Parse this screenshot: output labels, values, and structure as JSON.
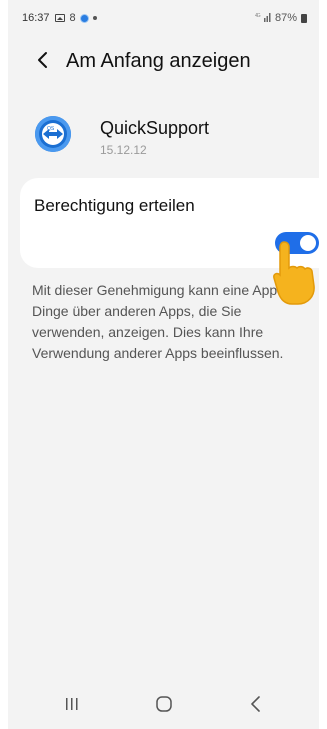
{
  "status_bar": {
    "time": "16:37",
    "notification_number": "8",
    "battery": "87%",
    "network": "4G"
  },
  "header": {
    "title": "Am Anfang anzeigen"
  },
  "app": {
    "name": "QuickSupport",
    "version": "15.12.12",
    "icon": "teamviewer-quicksupport-icon"
  },
  "permission": {
    "label": "Berechtigung erteilen",
    "enabled": true
  },
  "description": "Mit dieser Genehmigung kann eine App Dinge über anderen Apps, die Sie verwenden, anzeigen. Dies kann Ihre Verwendung anderer Apps beeinflussen.",
  "navbar": {
    "items": [
      "recent-apps",
      "home",
      "back"
    ]
  },
  "colors": {
    "accent": "#1f6ee8",
    "background": "#f3f3f3",
    "hand": "#f5b31e"
  }
}
